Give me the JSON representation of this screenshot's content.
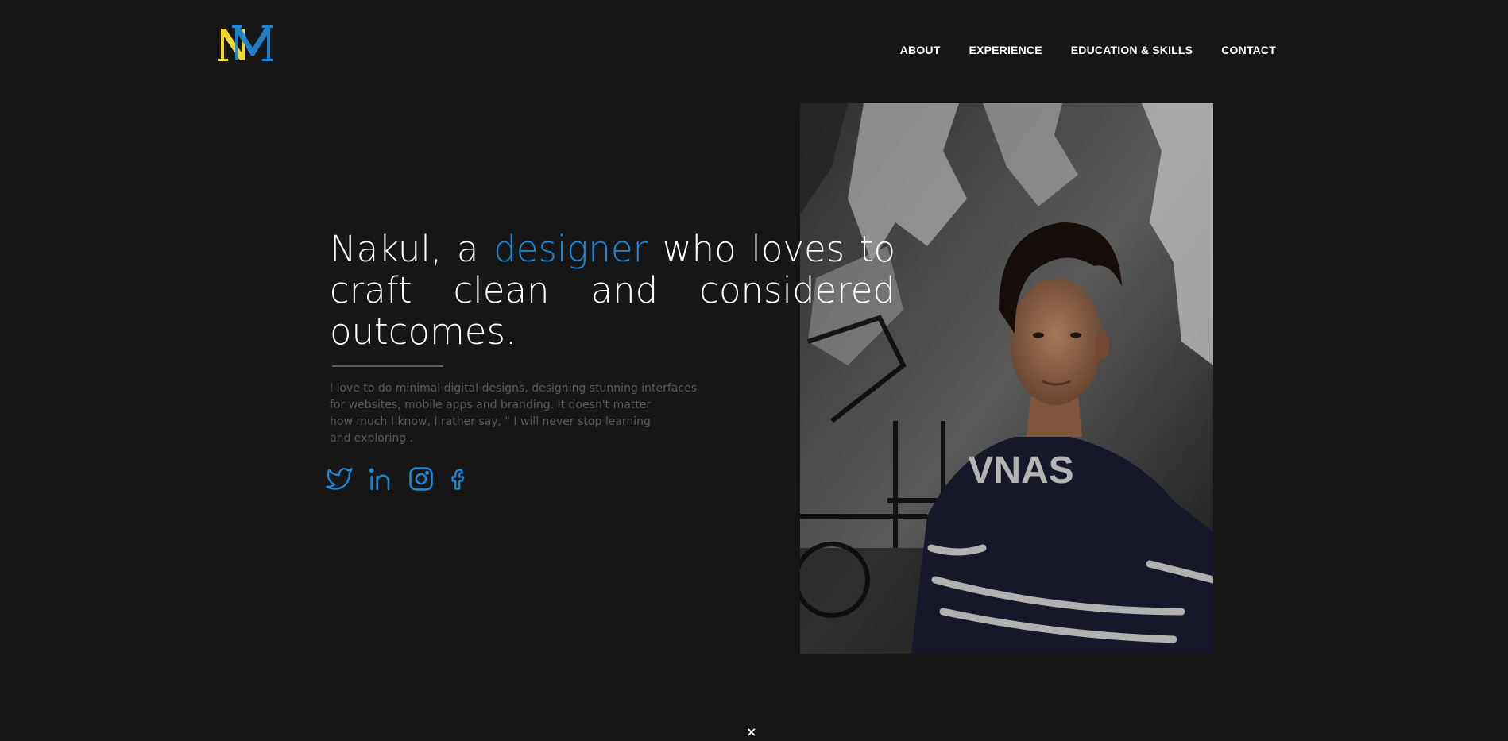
{
  "header": {
    "logo_icon": "nm-monogram-logo",
    "nav": [
      {
        "label": "ABOUT"
      },
      {
        "label": "EXPERIENCE"
      },
      {
        "label": "EDUCATION & SKILLS"
      },
      {
        "label": "CONTACT"
      }
    ]
  },
  "hero": {
    "title_before": "Nakul, a ",
    "title_accent": "designer",
    "title_after": " who loves to craft clean and considered outcomes.",
    "description_lines": [
      "I love to do minimal digital designs, designing stunning interfaces",
      "for websites, mobile apps and branding. It doesn't matter",
      "how much I know, I rather say, \" I will never stop learning",
      "and exploring ."
    ],
    "socials": [
      {
        "icon": "twitter-icon"
      },
      {
        "icon": "linkedin-icon"
      },
      {
        "icon": "instagram-icon"
      },
      {
        "icon": "facebook-icon"
      }
    ]
  },
  "photo": {
    "sweater_text": "VNAS"
  },
  "footer": {
    "close_glyph": "×"
  },
  "colors": {
    "background": "#161617",
    "accent": "#1e88d6",
    "logo_yellow": "#f2d82a",
    "logo_blue": "#1e88d6",
    "muted_text": "#5a5a5a"
  }
}
